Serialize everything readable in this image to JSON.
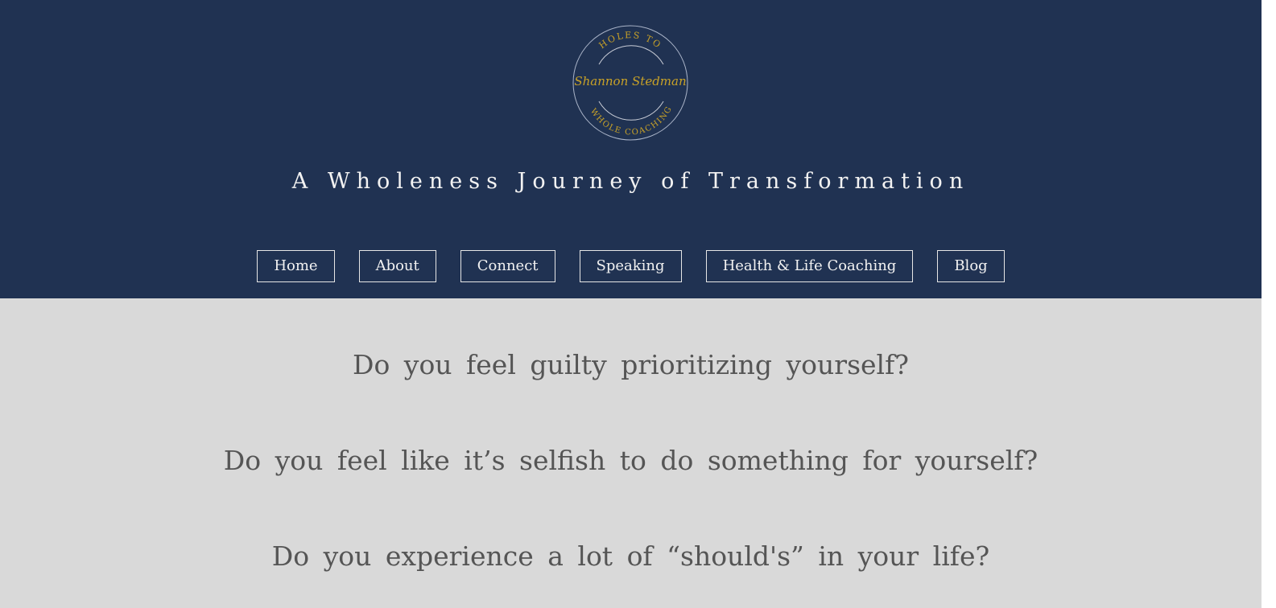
{
  "logo": {
    "top_text": "HOLES TO",
    "script_text": "Shannon Stedman",
    "bottom_text": "WHOLE COACHING",
    "gold_color": "#c9a227",
    "ring_color": "#aab4c8"
  },
  "header": {
    "background": "#203252",
    "tagline": "A Wholeness Journey of Transformation"
  },
  "nav": {
    "items": [
      {
        "label": "Home"
      },
      {
        "label": "About"
      },
      {
        "label": "Connect"
      },
      {
        "label": "Speaking"
      },
      {
        "label": "Health & Life Coaching"
      },
      {
        "label": "Blog"
      }
    ]
  },
  "main": {
    "background": "#d9d9d9",
    "questions": [
      "Do you feel guilty prioritizing yourself?",
      "Do you feel like it’s selfish to do something for yourself?",
      "Do you experience a lot of “should's” in your life?"
    ]
  }
}
